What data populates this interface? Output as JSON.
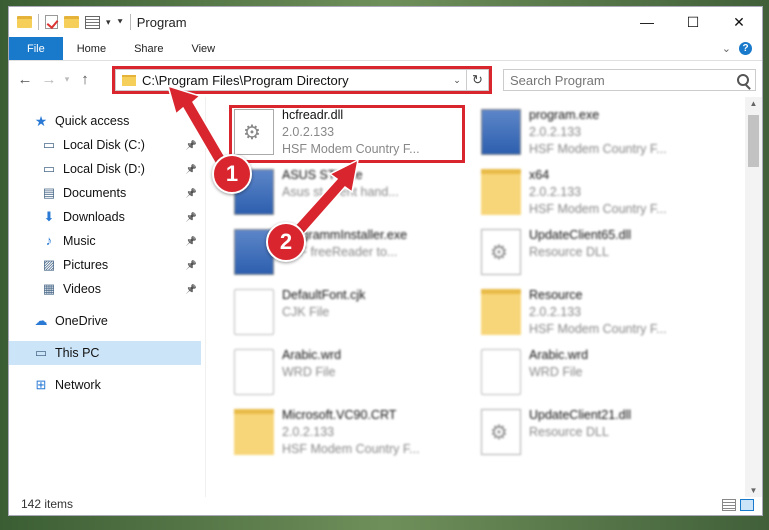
{
  "window": {
    "title": "Program",
    "controls": {
      "minimize": "—",
      "maximize": "☐",
      "close": "✕"
    }
  },
  "ribbon": {
    "tabs": [
      "File",
      "Home",
      "Share",
      "View"
    ],
    "help": "?"
  },
  "nav": {
    "back": "←",
    "forward": "→",
    "up": "↑",
    "address": "C:\\Program Files\\Program Directory",
    "search_placeholder": "Search Program"
  },
  "sidebar": {
    "items": [
      {
        "label": "Quick access",
        "icon": "star-icon",
        "pinned": false
      },
      {
        "label": "Local Disk (C:)",
        "icon": "drive-icon",
        "pinned": true
      },
      {
        "label": "Local Disk (D:)",
        "icon": "drive-icon",
        "pinned": true
      },
      {
        "label": "Documents",
        "icon": "documents-icon",
        "pinned": true
      },
      {
        "label": "Downloads",
        "icon": "download-icon",
        "pinned": true
      },
      {
        "label": "Music",
        "icon": "music-icon",
        "pinned": true
      },
      {
        "label": "Pictures",
        "icon": "pictures-icon",
        "pinned": true
      },
      {
        "label": "Videos",
        "icon": "videos-icon",
        "pinned": true
      },
      {
        "label": "OneDrive",
        "icon": "cloud-icon",
        "pinned": false
      },
      {
        "label": "This PC",
        "icon": "computer-icon",
        "pinned": false,
        "selected": true
      },
      {
        "label": "Network",
        "icon": "network-icon",
        "pinned": false
      }
    ]
  },
  "files": [
    {
      "name": "hcfreadr.dll",
      "line2": "2.0.2.133",
      "line3": "HSF Modem Country F...",
      "icon": "dll-icon",
      "highlighted": true
    },
    {
      "name": "program.exe",
      "line2": "2.0.2.133",
      "line3": "HSF Modem Country F...",
      "icon": "exe-icon",
      "blurred": true
    },
    {
      "name": "ASUS STI.exe",
      "line2": "Asus st event hand...",
      "line3": "",
      "icon": "exe-icon",
      "blurred": true
    },
    {
      "name": "x64",
      "line2": "2.0.2.133",
      "line3": "HSF Modem Country F...",
      "icon": "folder-icon",
      "blurred": true
    },
    {
      "name": "ProgrammInstaller.exe",
      "line2": "HSF freeReader to...",
      "line3": "",
      "icon": "exe-icon",
      "blurred": true
    },
    {
      "name": "UpdateClient65.dll",
      "line2": "Resource DLL",
      "line3": "",
      "icon": "dll-icon",
      "blurred": true
    },
    {
      "name": "DefaultFont.cjk",
      "line2": "CJK File",
      "line3": "",
      "icon": "file-icon",
      "blurred": true
    },
    {
      "name": "Resource",
      "line2": "2.0.2.133",
      "line3": "HSF Modem Country F...",
      "icon": "folder-icon",
      "blurred": true
    },
    {
      "name": "Arabic.wrd",
      "line2": "WRD File",
      "line3": "",
      "icon": "file-icon",
      "blurred": true
    },
    {
      "name": "Arabic.wrd",
      "line2": "WRD File",
      "line3": "",
      "icon": "file-icon",
      "blurred": true
    },
    {
      "name": "Microsoft.VC90.CRT",
      "line2": "2.0.2.133",
      "line3": "HSF Modem Country F...",
      "icon": "folder-icon",
      "blurred": true
    },
    {
      "name": "UpdateClient21.dll",
      "line2": "Resource DLL",
      "line3": "",
      "icon": "dll-icon",
      "blurred": true
    }
  ],
  "markers": [
    "1",
    "2"
  ],
  "status": {
    "item_count": "142 items"
  },
  "colors": {
    "accent": "#1979ca",
    "highlight": "#d9252e",
    "selection": "#cce4f7"
  }
}
